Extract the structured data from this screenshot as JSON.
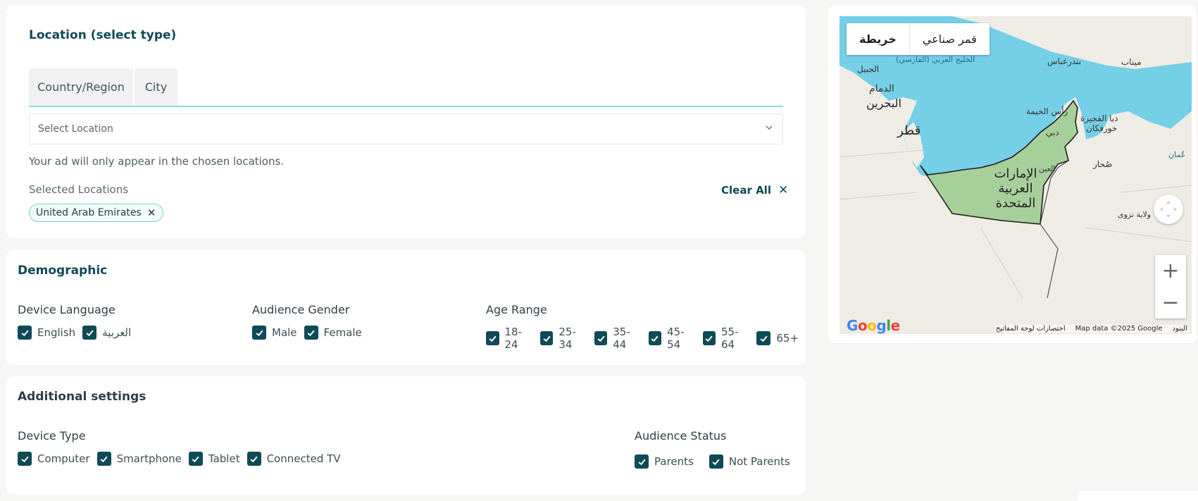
{
  "location": {
    "title": "Location (select type)",
    "tabs": [
      "Country/Region",
      "City"
    ],
    "select_placeholder": "Select Location",
    "hint": "Your ad will only appear in the chosen locations.",
    "selected_label": "Selected Locations",
    "clear_all": "Clear All",
    "chips": [
      "United Arab Emirates"
    ]
  },
  "demographic": {
    "title": "Demographic",
    "device_language": {
      "label": "Device Language",
      "options": [
        "English",
        "العربية"
      ]
    },
    "audience_gender": {
      "label": "Audience Gender",
      "options": [
        "Male",
        "Female"
      ]
    },
    "age_range": {
      "label": "Age Range",
      "options": [
        "18-24",
        "25-34",
        "35-44",
        "45-54",
        "55-64",
        "65+"
      ]
    }
  },
  "additional": {
    "title": "Additional settings",
    "device_type": {
      "label": "Device Type",
      "options": [
        "Computer",
        "Smartphone",
        "Tablet",
        "Connected TV"
      ]
    },
    "audience_status": {
      "label": "Audience Status",
      "options": [
        "Parents",
        "Not Parents"
      ]
    }
  },
  "map": {
    "toggle_map": "خريطة",
    "toggle_satellite": "قمر صناعي",
    "labels": {
      "uae": "الإمارات العربية المتحدة",
      "qatar": "قطر",
      "bahrain": "البحرين",
      "dammam": "الدمام",
      "jubail": "الجبيل",
      "gulf": "الخليج العربي (الفارسي)",
      "bandar_abbas": "بندرعباس",
      "minab": "ميناب",
      "ras_al_khaimah": "رأس الخيمة",
      "dubai": "دبي",
      "fujairah": "دبا الفجيرة",
      "khorfakkan": "خورفكان",
      "sohar": "صُحار",
      "al_ain": "العين",
      "oman": "عُمان",
      "nizwa": "ولاية نزوى"
    },
    "google": "Google",
    "shortcuts": "اختصارات لوحة المفاتيح",
    "map_data": "Map data ©2025 Google",
    "terms": "البنود"
  },
  "colors": {
    "brand": "#0f4a57",
    "accent": "#7ee3d9",
    "water": "#75cfe6",
    "uae_fill": "#a7cf9a"
  }
}
